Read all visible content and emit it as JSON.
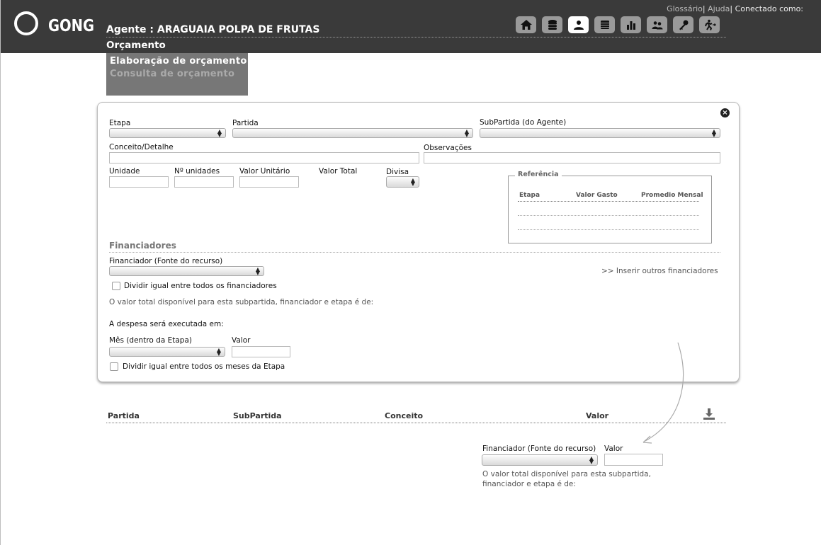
{
  "header": {
    "logo_text": "GONG",
    "agent_title": "Agente : ARAGUAIA POLPA DE FRUTAS",
    "section_title": "Orçamento",
    "links": {
      "glossary": "Glossário",
      "sep1": "|",
      "help": "Ajuda",
      "sep2": "|",
      "user": "Conectado como:"
    },
    "nav_icons": [
      "home-icon",
      "database-icon",
      "user-icon",
      "book-icon",
      "bar-chart-icon",
      "users-icon",
      "key-icon",
      "exit-icon"
    ]
  },
  "submenu": {
    "item1": "Elaboração de orçamento",
    "item2": "Consulta de orçamento"
  },
  "form": {
    "etapa_label": "Etapa",
    "partida_label": "Partida",
    "subpartida_label": "SubPartida (do Agente)",
    "conceito_label": "Conceito/Detalhe",
    "observacoes_label": "Observações",
    "unidade_label": "Unidade",
    "n_unidades_label": "Nº unidades",
    "valor_unitario_label": "Valor Unitário",
    "valor_total_label": "Valor Total",
    "divisa_label": "Divisa",
    "referencia": {
      "legend": "Referência",
      "col1": "Etapa",
      "col2": "Valor Gasto",
      "col3": "Promedio Mensal"
    },
    "financiadores_title": "Financiadores",
    "financiador_label": "Financiador (Fonte do recurso)",
    "inserir_link": ">> Inserir outros financiadores",
    "dividir_financiadores": "Dividir igual entre todos os financiadores",
    "valor_total_text": "O valor total disponível para esta subpartida, financiador e etapa é de:",
    "despesa_text": "A despesa será executada em:",
    "mes_label": "Mês (dentro da Etapa)",
    "valor_label": "Valor",
    "dividir_meses": "Dividir igual entre todos os meses da Etapa"
  },
  "table": {
    "col_partida": "Partida",
    "col_subpartida": "SubPartida",
    "col_conceito": "Conceito",
    "col_valor": "Valor"
  },
  "lower": {
    "financiador_label": "Financiador (Fonte do recurso)",
    "valor_label": "Valor",
    "text_line1": "O valor total disponível para esta subpartida,",
    "text_line2": "financiador e etapa é de:"
  }
}
